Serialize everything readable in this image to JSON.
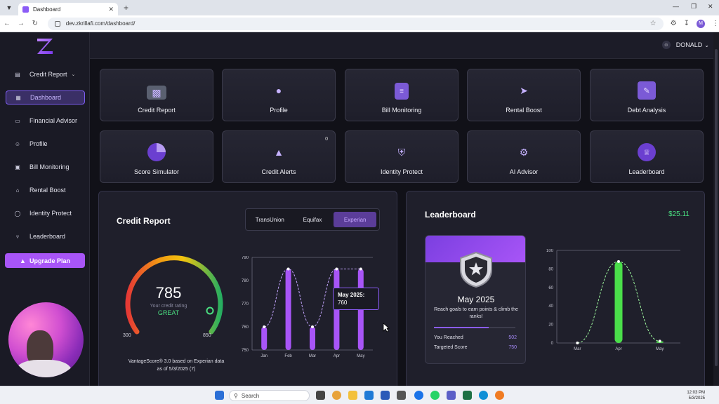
{
  "browser": {
    "tab_title": "Dashboard",
    "url": "dev.zkrillafi.com/dashboard/",
    "profile_initial": "M"
  },
  "user": {
    "name": "DONALD"
  },
  "sidebar": {
    "items": [
      {
        "label": "Credit Report",
        "icon": "document-icon"
      },
      {
        "label": "Dashboard",
        "icon": "grid-icon"
      },
      {
        "label": "Financial Advisor",
        "icon": "chat-icon"
      },
      {
        "label": "Profile",
        "icon": "user-icon"
      },
      {
        "label": "Bill Monitoring",
        "icon": "lock-icon"
      },
      {
        "label": "Rental Boost",
        "icon": "home-icon"
      },
      {
        "label": "Identity Protect",
        "icon": "shield-icon"
      },
      {
        "label": "Leaderboard",
        "icon": "trophy-icon"
      }
    ],
    "upgrade_label": "Upgrade Plan"
  },
  "cards": [
    {
      "label": "Credit Report",
      "icon": "bar-chart-icon"
    },
    {
      "label": "Profile",
      "icon": "user-icon"
    },
    {
      "label": "Bill Monitoring",
      "icon": "receipt-icon"
    },
    {
      "label": "Rental Boost",
      "icon": "rocket-icon"
    },
    {
      "label": "Debt Analysis",
      "icon": "analysis-icon"
    },
    {
      "label": "Score Simulator",
      "icon": "pie-icon"
    },
    {
      "label": "Credit Alerts",
      "icon": "alert-icon",
      "badge": "0"
    },
    {
      "label": "Identity Protect",
      "icon": "shield-icon"
    },
    {
      "label": "AI Advisor",
      "icon": "brain-icon"
    },
    {
      "label": "Leaderboard",
      "icon": "trophy-icon"
    }
  ],
  "credit_report": {
    "title": "Credit Report",
    "bureaus": [
      "TransUnion",
      "Equifax",
      "Experian"
    ],
    "active_bureau": "Experian",
    "score": "785",
    "score_caption": "Your credit rating",
    "rating": "GREAT",
    "min": "300",
    "max": "850",
    "footnote_line1": "VantageScore® 3.0 based on Experian data",
    "footnote_line2": "as of 5/3/2025",
    "footnote_count": "(7)",
    "tooltip_month": "May 2025:",
    "tooltip_value": "760"
  },
  "leaderboard": {
    "title": "Leaderboard",
    "amount": "$25.11",
    "month": "May 2025",
    "description": "Reach goals to earn points & climb the ranks!",
    "you_reached_label": "You Reached",
    "you_reached_value": "502",
    "target_label": "Targeted Score",
    "target_value": "750",
    "progress": 0.67
  },
  "taskbar": {
    "search_placeholder": "Search",
    "time": "12:03 PM",
    "date": "5/3/2025"
  },
  "chart_data": [
    {
      "type": "bar",
      "categories": [
        "Jan",
        "Feb",
        "Mar",
        "Apr",
        "May"
      ],
      "series": [
        {
          "values": [
            760,
            785,
            760,
            785,
            785
          ]
        }
      ],
      "ylim": [
        750,
        790
      ],
      "yticks": [
        750,
        760,
        770,
        780,
        790
      ],
      "color": "#a855f7"
    },
    {
      "type": "bar",
      "categories": [
        "Mar",
        "Apr",
        "May"
      ],
      "series": [
        {
          "values": [
            0,
            88,
            2
          ]
        }
      ],
      "ylim": [
        0,
        100
      ],
      "yticks": [
        0,
        20,
        40,
        60,
        80,
        100
      ],
      "color": "#4ade4a"
    }
  ]
}
